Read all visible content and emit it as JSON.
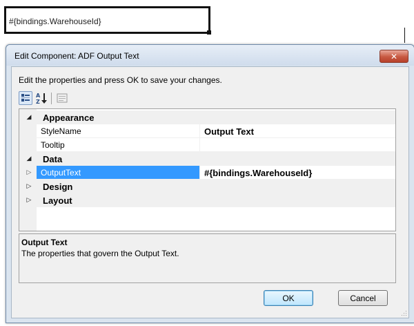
{
  "canvas": {
    "output_text": "#{bindings.WarehouseId}"
  },
  "dialog": {
    "title": "Edit Component: ADF Output Text",
    "close_glyph": "✕",
    "instructions": "Edit the properties and press OK to save your changes.",
    "toolbar": {
      "categorized_icon": "categorized-view-icon",
      "alphabetical_icon": "alphabetical-sort-icon",
      "pages_icon": "property-pages-icon"
    },
    "grid": {
      "appearance": {
        "label": "Appearance",
        "toggle": "◢"
      },
      "stylename": {
        "name": "StyleName",
        "value": "Output Text"
      },
      "tooltip": {
        "name": "Tooltip",
        "value": ""
      },
      "data": {
        "label": "Data",
        "toggle": "◢"
      },
      "outputtext": {
        "name": "OutputText",
        "value": "#{bindings.WarehouseId}",
        "toggle": "▷"
      },
      "design": {
        "label": "Design",
        "toggle": "▷"
      },
      "layout": {
        "label": "Layout",
        "toggle": "▷"
      }
    },
    "help": {
      "title": "Output Text",
      "description": "The properties that govern the Output Text."
    },
    "buttons": {
      "ok": "OK",
      "cancel": "Cancel"
    }
  }
}
